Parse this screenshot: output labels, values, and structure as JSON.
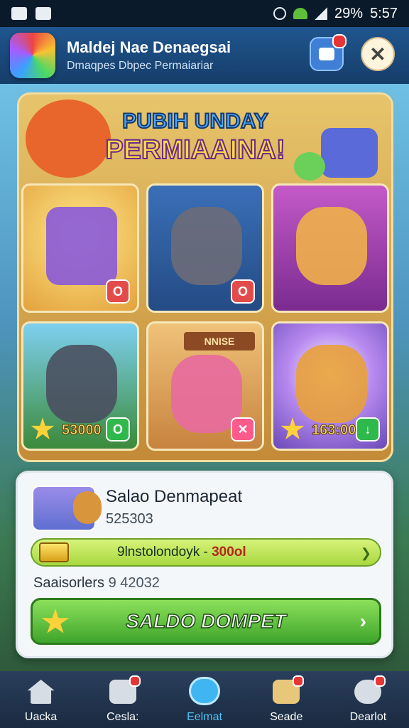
{
  "status_bar": {
    "battery": "29%",
    "time": "5:57"
  },
  "header": {
    "title": "Maldej Nae Denaegsai",
    "subtitle": "Dmaqpes Dbpec Permaiariar"
  },
  "banner": {
    "line1": "PUBIH UNDAY",
    "line2": "PERMIAAINA!"
  },
  "tiles": [
    {
      "name": "tile-truck",
      "sign": "",
      "score": ""
    },
    {
      "name": "tile-wolf",
      "sign": "",
      "score": ""
    },
    {
      "name": "tile-friends",
      "sign": "",
      "score": ""
    },
    {
      "name": "tile-knights",
      "sign": "",
      "score": "53000"
    },
    {
      "name": "tile-bunny",
      "sign": "NNISE",
      "score": ""
    },
    {
      "name": "tile-cats",
      "sign": "",
      "score": "163:00"
    }
  ],
  "wallet_card": {
    "title": "Salao Denmapeat",
    "id": "525303",
    "info_text": "9lnstolondoyk -",
    "info_amount": "300ol",
    "saldo_label": "Saaisorlers",
    "saldo_value": "9 42032",
    "cta_label": "SALDO DOMPET"
  },
  "nav": {
    "items": [
      {
        "label": "Uacka"
      },
      {
        "label": "Cesla:"
      },
      {
        "label": "Eelmat"
      },
      {
        "label": "Seade"
      },
      {
        "label": "Dearlot"
      }
    ]
  }
}
